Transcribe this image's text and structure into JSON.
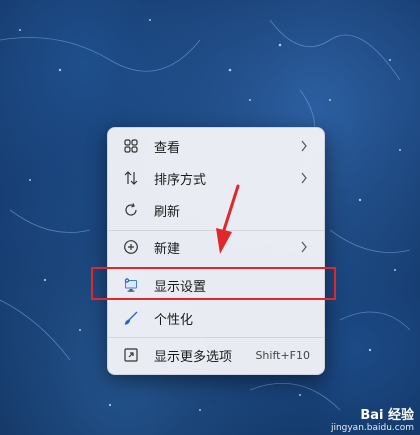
{
  "context_menu": {
    "items": [
      {
        "label": "查看",
        "icon": "view-grid-icon",
        "submenu": true
      },
      {
        "label": "排序方式",
        "icon": "sort-icon",
        "submenu": true
      },
      {
        "label": "刷新",
        "icon": "refresh-icon",
        "submenu": false
      },
      {
        "label": "新建",
        "icon": "new-plus-icon",
        "submenu": true
      },
      {
        "label": "显示设置",
        "icon": "display-settings-icon",
        "submenu": false
      },
      {
        "label": "个性化",
        "icon": "personalize-brush-icon",
        "submenu": false
      },
      {
        "label": "显示更多选项",
        "icon": "more-options-icon",
        "shortcut": "Shift+F10"
      }
    ]
  },
  "annotation": {
    "highlight_color": "#e0272b"
  },
  "watermark": {
    "brand": "Bai 经验",
    "url": "jingyan.baidu.com"
  }
}
